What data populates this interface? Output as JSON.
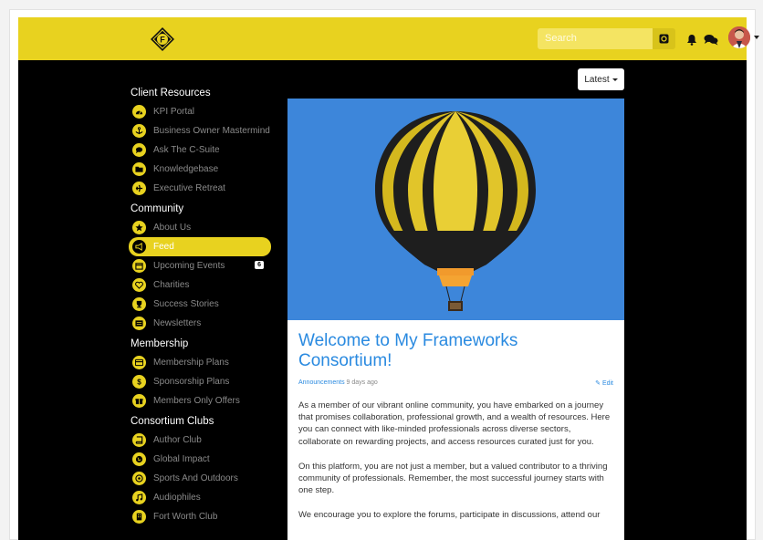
{
  "header": {
    "search_placeholder": "Search"
  },
  "sidebar": {
    "sections": [
      {
        "title": "Client Resources",
        "items": [
          {
            "label": "KPI Portal",
            "icon": "dashboard-icon"
          },
          {
            "label": "Business Owner Mastermind",
            "icon": "anchor-icon"
          },
          {
            "label": "Ask The C-Suite",
            "icon": "chat-icon"
          },
          {
            "label": "Knowledgebase",
            "icon": "folder-icon"
          },
          {
            "label": "Executive Retreat",
            "icon": "plane-icon"
          }
        ]
      },
      {
        "title": "Community",
        "items": [
          {
            "label": "About Us",
            "icon": "star-icon"
          },
          {
            "label": "Feed",
            "icon": "megaphone-icon",
            "active": true
          },
          {
            "label": "Upcoming Events",
            "icon": "calendar-icon",
            "badge": "6"
          },
          {
            "label": "Charities",
            "icon": "heart-icon"
          },
          {
            "label": "Success Stories",
            "icon": "trophy-icon"
          },
          {
            "label": "Newsletters",
            "icon": "newspaper-icon"
          }
        ]
      },
      {
        "title": "Membership",
        "items": [
          {
            "label": "Membership Plans",
            "icon": "card-icon"
          },
          {
            "label": "Sponsorship Plans",
            "icon": "dollar-icon"
          },
          {
            "label": "Members Only Offers",
            "icon": "gift-icon"
          }
        ]
      },
      {
        "title": "Consortium Clubs",
        "items": [
          {
            "label": "Author Club",
            "icon": "book-icon"
          },
          {
            "label": "Global Impact",
            "icon": "globe-icon"
          },
          {
            "label": "Sports And Outdoors",
            "icon": "ball-icon"
          },
          {
            "label": "Audiophiles",
            "icon": "music-icon"
          },
          {
            "label": "Fort Worth Club",
            "icon": "building-icon"
          }
        ]
      }
    ]
  },
  "feed": {
    "sort_label": "Latest",
    "post": {
      "title": "Welcome to My Frameworks Consortium!",
      "category": "Announcements",
      "ago": "9 days ago",
      "edit_label": "Edit",
      "paragraphs": [
        "As a member of our vibrant online community, you have embarked on a journey that promises collaboration, professional growth, and a wealth of resources. Here you can connect with like-minded professionals across diverse sectors, collaborate on rewarding projects, and access resources curated just for you.",
        "On this platform, you are not just a member, but a valued contributor to a thriving community of professionals. Remember, the most successful journey starts with one step.",
        "We encourage you to explore the forums, participate in discussions, attend our"
      ]
    }
  },
  "colors": {
    "brand_yellow": "#e8d21f",
    "link_blue": "#2a8ae0",
    "sky_blue": "#3d86da"
  }
}
